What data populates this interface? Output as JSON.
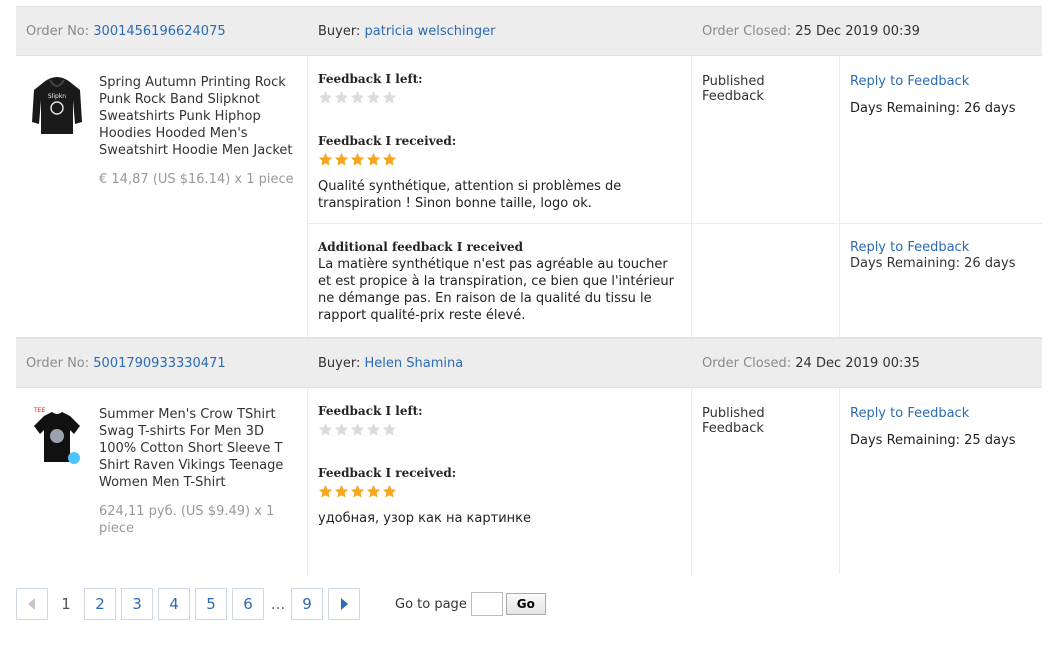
{
  "orders": [
    {
      "order_no_label": "Order No:",
      "order_no": "3001456196624075",
      "buyer_label": "Buyer:",
      "buyer": "patricia welschinger",
      "closed_label": "Order Closed:",
      "closed": "25 Dec 2019 00:39",
      "product_title": "Spring Autumn Printing Rock Punk Rock Band Slipknot Sweatshirts Punk Hiphop Hoodies Hooded Men's Sweatshirt Hoodie Men Jacket",
      "product_price": "€ 14,87 (US $16.14) x 1 piece",
      "feedback_left_label": "Feedback I left:",
      "feedback_left_stars": 0,
      "feedback_received_label": "Feedback I received:",
      "feedback_received_stars": 5,
      "feedback_received_comment": "Qualité synthétique, attention si problèmes de transpiration ! Sinon bonne taille, logo ok.",
      "status": "Published Feedback",
      "reply_label": "Reply to Feedback",
      "days_remaining": "Days Remaining: 26 days",
      "additional_label": "Additional feedback I received",
      "additional_comment": "La matière synthétique n'est pas agréable au toucher et est propice à la transpiration, ce bien que l'intérieur ne démange pas. En raison de la qualité du tissu le rapport qualité-prix reste élevé.",
      "additional_reply_label": "Reply to Feedback",
      "additional_days_remaining": "Days Remaining: 26 days"
    },
    {
      "order_no_label": "Order No:",
      "order_no": "5001790933330471",
      "buyer_label": "Buyer:",
      "buyer": "Helen Shamina",
      "closed_label": "Order Closed:",
      "closed": "24 Dec 2019 00:35",
      "product_title": "Summer Men's Crow TShirt Swag T-shirts For Men 3D 100% Cotton Short Sleeve T Shirt Raven Vikings Teenage Women Men T-Shirt",
      "product_price": "624,11 руб. (US $9.49) x 1 piece",
      "feedback_left_label": "Feedback I left:",
      "feedback_left_stars": 0,
      "feedback_received_label": "Feedback I received:",
      "feedback_received_stars": 5,
      "feedback_received_comment": "удобная, узор как на картинке",
      "status": "Published Feedback",
      "reply_label": "Reply to Feedback",
      "days_remaining": "Days Remaining: 25 days"
    }
  ],
  "pager": {
    "current": "1",
    "pages": [
      "2",
      "3",
      "4",
      "5",
      "6"
    ],
    "ellipsis": "...",
    "last": "9",
    "goto_label": "Go to page",
    "goto_value": "",
    "go_button": "Go"
  },
  "colors": {
    "link": "#2a6bb3",
    "star_on": "#f5a623",
    "star_off": "#dcdcdc",
    "header_bg": "#ededed"
  }
}
